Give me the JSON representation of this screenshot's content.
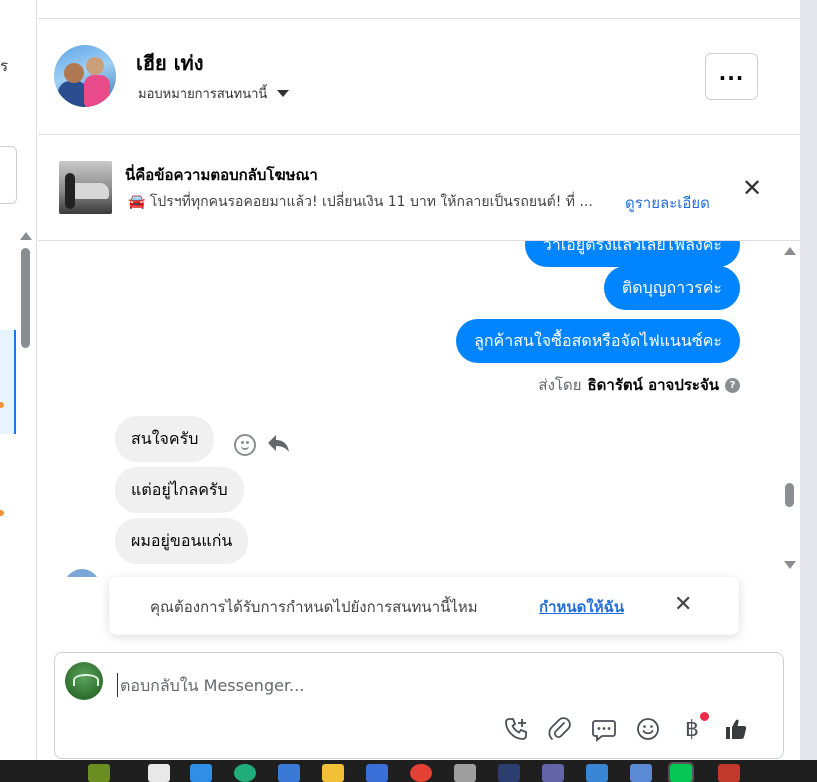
{
  "left_pane": {
    "fragment_text": "ร"
  },
  "header": {
    "contact_name": "เฮีย เท่ง",
    "assign_label": "มอบหมายการสนทนานี้",
    "more_label": "..."
  },
  "ad_banner": {
    "title": "นี่คือข้อความตอบกลับโฆษณา",
    "description": "🚘 โปรฯที่ทุกคนรอคอยมาแล้ว! เปลี่ยนเงิน 11 บาท ให้กลายเป็นรถยนต์! ที่ ...",
    "details_link": "ดูรายละเอียด",
    "close_label": "✕"
  },
  "messages": {
    "outgoing": [
      {
        "text": "ว่าเอยู่ตรงแล้วเลยไฟลงค่ะ"
      },
      {
        "text": "ติดบุญถาวรค่ะ"
      },
      {
        "text": "ลูกค้าสนใจซื้อสดหรือจัดไฟแนนซ์คะ"
      }
    ],
    "sent_by_prefix": "ส่งโดย",
    "sent_by_name": "ธิดารัตน์ อาจประจัน",
    "incoming": [
      {
        "text": "สนใจครับ"
      },
      {
        "text": "แต่อยู่ไกลครับ"
      },
      {
        "text": "ผมอยู่ขอนแก่น"
      }
    ]
  },
  "assign_prompt": {
    "text": "คุณต้องการได้รับการกำหนดไปยังการสนทนานี้ไหม",
    "action": "กำหนดให้ฉัน",
    "close_label": "✕"
  },
  "composer": {
    "placeholder": "ตอบกลับใน Messenger...",
    "value": "",
    "baht_symbol": "฿"
  },
  "colors": {
    "outgoing_bubble": "#0084ff",
    "incoming_bubble": "#f0f0f0",
    "link": "#216fdb",
    "notification_dot": "#f02849"
  }
}
